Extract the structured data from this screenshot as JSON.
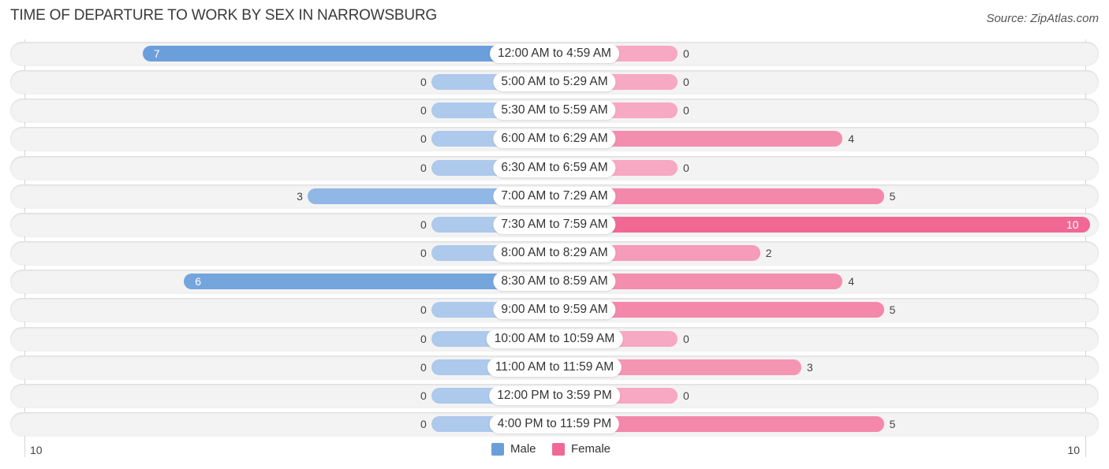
{
  "chart_data": {
    "type": "bar",
    "orientation": "horizontal-diverging",
    "title": "TIME OF DEPARTURE TO WORK BY SEX IN NARROWSBURG",
    "source": "Source: ZipAtlas.com",
    "categories": [
      "12:00 AM to 4:59 AM",
      "5:00 AM to 5:29 AM",
      "5:30 AM to 5:59 AM",
      "6:00 AM to 6:29 AM",
      "6:30 AM to 6:59 AM",
      "7:00 AM to 7:29 AM",
      "7:30 AM to 7:59 AM",
      "8:00 AM to 8:29 AM",
      "8:30 AM to 8:59 AM",
      "9:00 AM to 9:59 AM",
      "10:00 AM to 10:59 AM",
      "11:00 AM to 11:59 AM",
      "12:00 PM to 3:59 PM",
      "4:00 PM to 11:59 PM"
    ],
    "series": [
      {
        "name": "Male",
        "color": "#6a9fdb",
        "light_color": "#adc9ec",
        "values": [
          7,
          0,
          0,
          0,
          0,
          3,
          0,
          0,
          6,
          0,
          0,
          0,
          0,
          0
        ]
      },
      {
        "name": "Female",
        "color": "#f06893",
        "light_color": "#f7a8c2",
        "values": [
          0,
          0,
          0,
          4,
          0,
          5,
          10,
          2,
          4,
          5,
          0,
          3,
          0,
          5
        ]
      }
    ],
    "axis": {
      "left_tick": "10",
      "right_tick": "10",
      "xlim": [
        -10,
        10
      ]
    },
    "legend": {
      "position": "bottom-center",
      "items": [
        "Male",
        "Female"
      ]
    },
    "xlabel": "",
    "ylabel": ""
  }
}
